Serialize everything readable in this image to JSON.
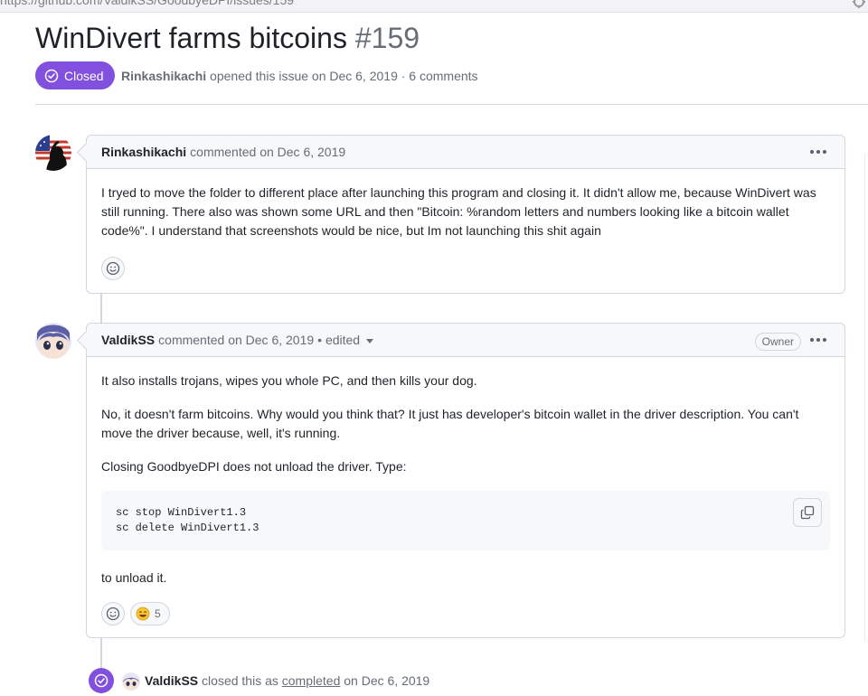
{
  "browser": {
    "url": "https://github.com/ValdikSS/GoodbyeDPI/issues/159"
  },
  "issue": {
    "title": "WinDivert farms bitcoins",
    "number": "#159",
    "state": "Closed",
    "author": "Rinkashikachi",
    "opened_text": "opened this issue on Dec 6, 2019 · 6 comments"
  },
  "comments": [
    {
      "author": "Rinkashikachi",
      "action": "commented on Dec 6, 2019",
      "body": [
        "I tryed to move the folder to different place after launching this program and closing it. It didn't allow me, because WinDivert was still running. There also was shown some URL and then \"Bitcoin: %random letters and numbers looking like a bitcoin wallet code%\". I understand that screenshots would be nice, but Im not launching this shit again"
      ]
    },
    {
      "author": "ValdikSS",
      "action": "commented on Dec 6, 2019",
      "edited": "• edited",
      "role": "Owner",
      "body": [
        "It also installs trojans, wipes you whole PC, and then kills your dog.",
        "No, it doesn't farm bitcoins. Why would you think that? It just has developer's bitcoin wallet in the driver description. You can't move the driver because, well, it's running.",
        "Closing GoodbyeDPI does not unload the driver. Type:"
      ],
      "code": [
        "sc stop WinDivert1.3",
        "sc delete WinDivert1.3"
      ],
      "after_code": "to unload it.",
      "reaction_count": "5"
    }
  ],
  "event": {
    "actor": "ValdikSS",
    "text_before": "closed this as",
    "link": "completed",
    "text_after": "on Dec 6, 2019"
  },
  "colors": {
    "closed_purple": "#8250df",
    "border": "#d0d7de",
    "muted": "#656d76"
  },
  "icons": [
    "check-circle-icon",
    "kebab-icon",
    "smiley-icon",
    "copy-icon",
    "grinning-emoji-icon"
  ]
}
